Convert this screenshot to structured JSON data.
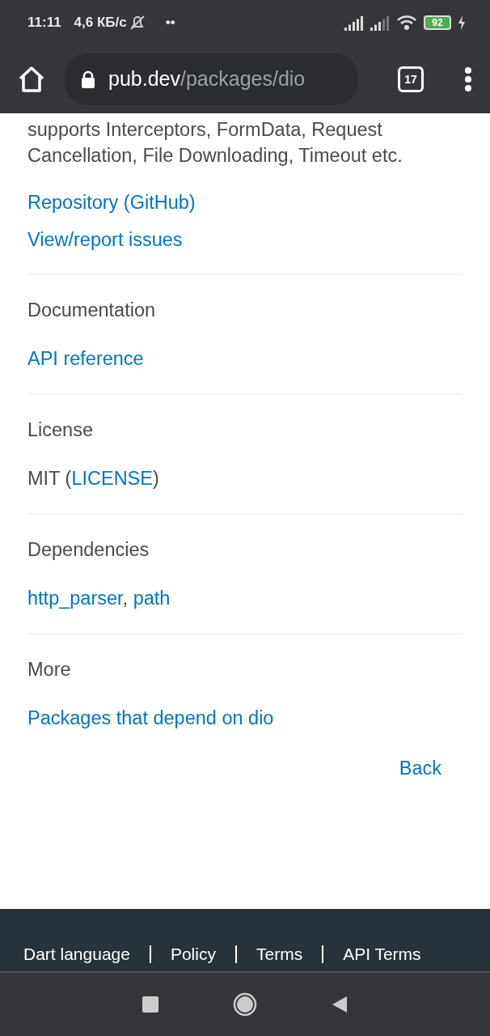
{
  "status_bar": {
    "time": "11:11",
    "speed": "4,6 КБ/с",
    "dots": "••",
    "battery": "92"
  },
  "browser": {
    "domain": "pub.dev",
    "path": "/packages/dio",
    "tab_count": "17"
  },
  "intro": "supports Interceptors, FormData, Request Cancellation, File Downloading, Timeout etc.",
  "top_links": [
    "Repository (GitHub)",
    "View/report issues"
  ],
  "sections": [
    {
      "heading": "Documentation",
      "lines": [
        [
          {
            "kind": "link",
            "text": "API reference"
          }
        ]
      ]
    },
    {
      "heading": "License",
      "lines": [
        [
          {
            "kind": "text",
            "text": "MIT ("
          },
          {
            "kind": "link",
            "text": "LICENSE"
          },
          {
            "kind": "text",
            "text": ")"
          }
        ]
      ]
    },
    {
      "heading": "Dependencies",
      "lines": [
        [
          {
            "kind": "link",
            "text": "http_parser"
          },
          {
            "kind": "text",
            "text": ", "
          },
          {
            "kind": "link",
            "text": "path"
          }
        ]
      ]
    },
    {
      "heading": "More",
      "lines": [
        [
          {
            "kind": "link",
            "text": "Packages that depend on dio"
          }
        ]
      ]
    }
  ],
  "back": "Back",
  "footer_links": [
    "Dart language",
    "Policy",
    "Terms",
    "API Terms"
  ]
}
